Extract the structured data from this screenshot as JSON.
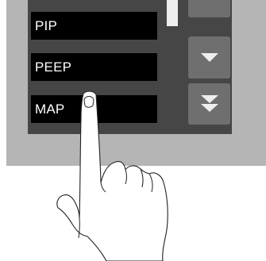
{
  "parameters": {
    "items": [
      {
        "label": "PIP"
      },
      {
        "label": "PEEP"
      },
      {
        "label": "MAP"
      }
    ]
  },
  "navigation": {
    "up_icon": "arrow-up-icon",
    "down_icon": "caret-down-icon",
    "page_down_icon": "double-chevron-down-icon"
  },
  "colors": {
    "bezel": "#b5b5b5",
    "panel": "#464646",
    "field": "#000000",
    "field_text": "#ffffff",
    "button": "#6f6f6f",
    "button_glyph": "#eeeeee",
    "scroll_thumb": "#efefef"
  }
}
